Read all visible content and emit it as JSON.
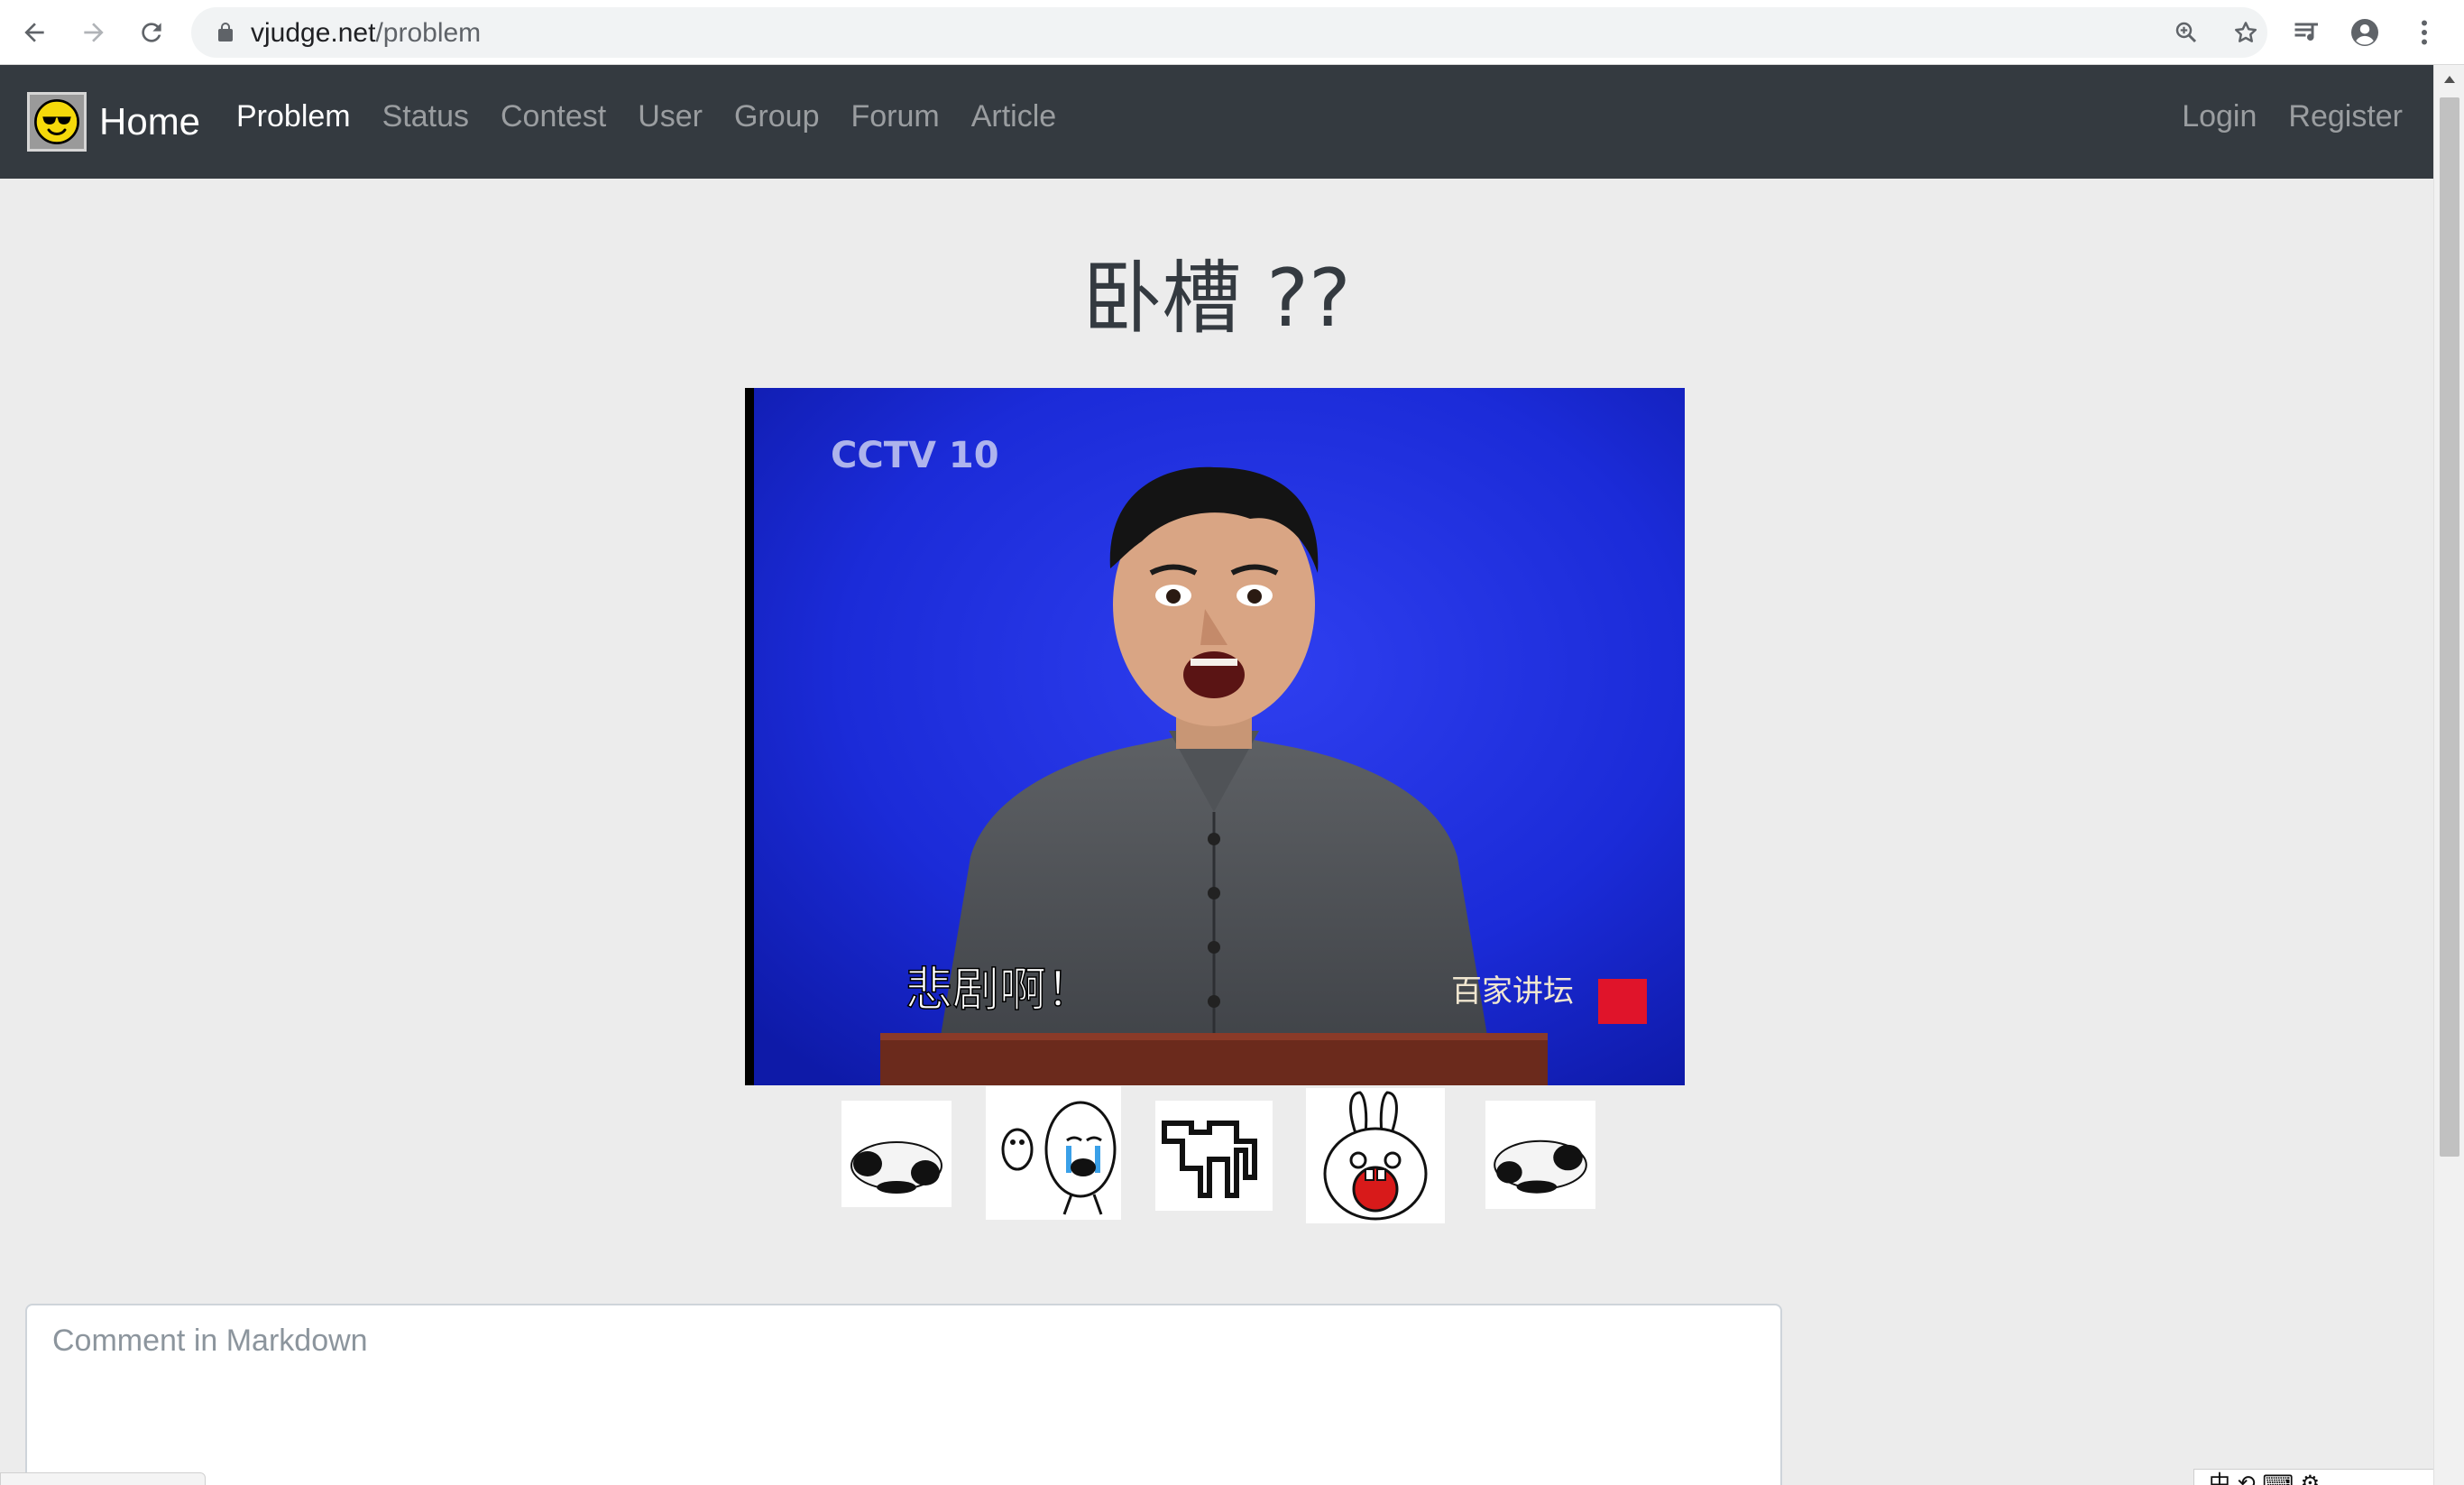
{
  "browser": {
    "url_host": "vjudge.net",
    "url_path": "/problem"
  },
  "navbar": {
    "brand": "Home",
    "links": [
      {
        "label": "Problem",
        "active": true
      },
      {
        "label": "Status"
      },
      {
        "label": "Contest"
      },
      {
        "label": "User"
      },
      {
        "label": "Group"
      },
      {
        "label": "Forum"
      },
      {
        "label": "Article"
      }
    ],
    "right_links": [
      {
        "label": "Login"
      },
      {
        "label": "Register"
      }
    ]
  },
  "main": {
    "title": "卧槽 ??",
    "photo": {
      "channel_logo": "CCTV 10",
      "subtitle": "悲剧啊！",
      "corner_logo": "百家讲坛"
    },
    "stickers": [
      "panda-lying",
      "crying-face-penguin",
      "pixel-figure",
      "rabbit-screaming",
      "panda-lying"
    ]
  },
  "comment": {
    "placeholder": "Comment in Markdown"
  },
  "ime_tray": {
    "text": "中 ⟲ ⌨ ⚙"
  },
  "colors": {
    "navbar_bg": "#343a40",
    "page_bg": "#ececec",
    "photo_bg": "#1a2ad6"
  }
}
